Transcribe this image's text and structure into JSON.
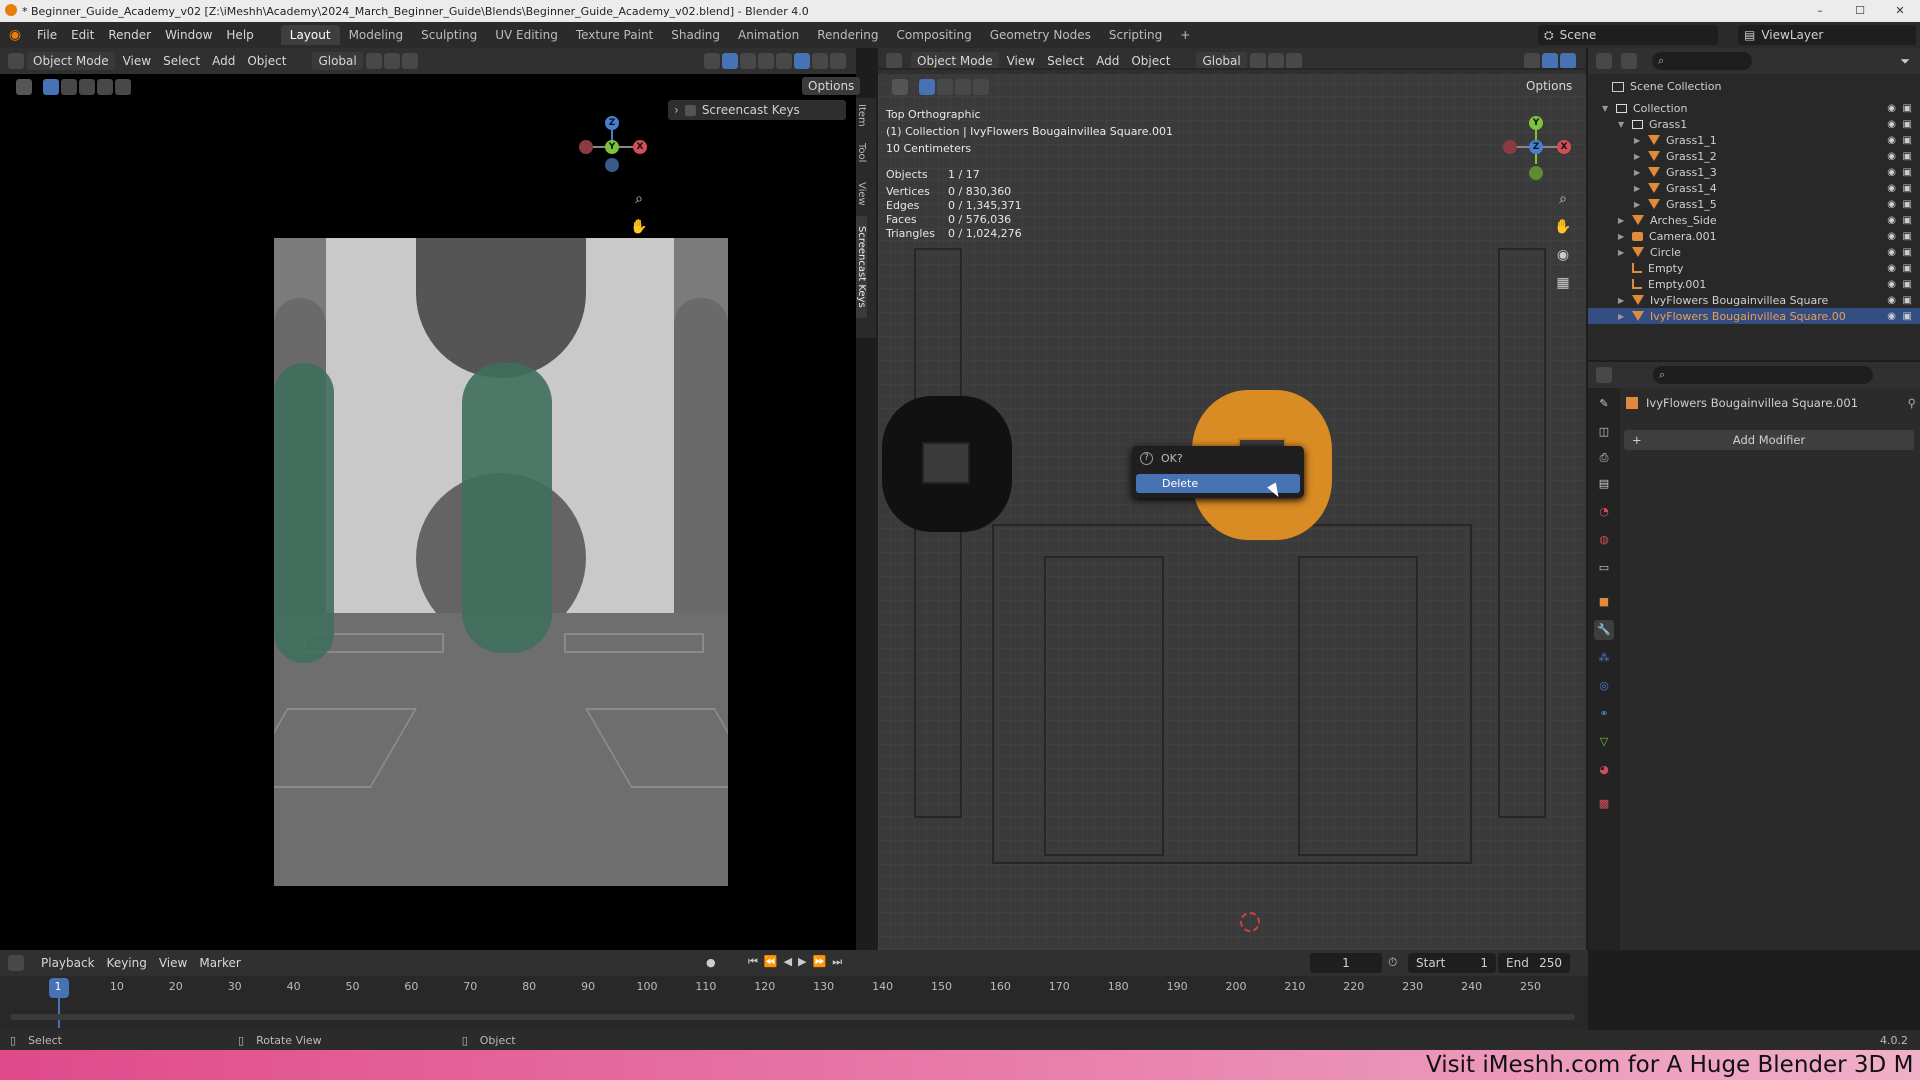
{
  "window": {
    "title": "* Beginner_Guide_Academy_v02 [Z:\\iMeshh\\Academy\\2024_March_Beginner_Guide\\Blends\\Beginner_Guide_Academy_v02.blend] - Blender 4.0",
    "controls": [
      "–",
      "☐",
      "✕"
    ]
  },
  "menubar": {
    "menus": [
      "File",
      "Edit",
      "Render",
      "Window",
      "Help"
    ],
    "workspaces": [
      "Layout",
      "Modeling",
      "Sculpting",
      "UV Editing",
      "Texture Paint",
      "Shading",
      "Animation",
      "Rendering",
      "Compositing",
      "Geometry Nodes",
      "Scripting",
      "+"
    ],
    "active_workspace": "Layout",
    "scene": "Scene",
    "view_layer": "ViewLayer"
  },
  "left_viewport": {
    "mode": "Object Mode",
    "menus": [
      "View",
      "Select",
      "Add",
      "Object"
    ],
    "transform": "Global",
    "options": "Options",
    "screencast_panel": "Screencast Keys",
    "side_tabs": [
      "Item",
      "Tool",
      "View",
      "Screencast Keys"
    ]
  },
  "right_viewport": {
    "mode": "Object Mode",
    "menus": [
      "View",
      "Select",
      "Add",
      "Object"
    ],
    "transform": "Global",
    "options": "Options",
    "view_name": "Top Orthographic",
    "collection_line": "(1) Collection | IvyFlowers Bougainvillea Square.001",
    "scale": "10 Centimeters",
    "stats": [
      {
        "label": "Objects",
        "value": "1 / 17"
      },
      {
        "label": "Vertices",
        "value": "0 / 830,360"
      },
      {
        "label": "Edges",
        "value": "0 / 1,345,371"
      },
      {
        "label": "Faces",
        "value": "0 / 576,036"
      },
      {
        "label": "Triangles",
        "value": "0 / 1,024,276"
      }
    ],
    "dialog": {
      "title": "OK?",
      "button": "Delete"
    }
  },
  "outliner": {
    "root": "Scene Collection",
    "rows": [
      {
        "label": "Collection",
        "indent": 1,
        "type": "collection"
      },
      {
        "label": "Grass1",
        "indent": 2,
        "type": "collection"
      },
      {
        "label": "Grass1_1",
        "indent": 3,
        "type": "mesh"
      },
      {
        "label": "Grass1_2",
        "indent": 3,
        "type": "mesh"
      },
      {
        "label": "Grass1_3",
        "indent": 3,
        "type": "mesh"
      },
      {
        "label": "Grass1_4",
        "indent": 3,
        "type": "mesh"
      },
      {
        "label": "Grass1_5",
        "indent": 3,
        "type": "mesh"
      },
      {
        "label": "Arches_Side",
        "indent": 2,
        "type": "mesh"
      },
      {
        "label": "Camera.001",
        "indent": 2,
        "type": "camera"
      },
      {
        "label": "Circle",
        "indent": 2,
        "type": "mesh"
      },
      {
        "label": "Empty",
        "indent": 2,
        "type": "empty"
      },
      {
        "label": "Empty.001",
        "indent": 2,
        "type": "empty"
      },
      {
        "label": "IvyFlowers Bougainvillea Square",
        "indent": 2,
        "type": "mesh"
      },
      {
        "label": "IvyFlowers Bougainvillea Square.00",
        "indent": 2,
        "type": "mesh-selected"
      }
    ]
  },
  "properties": {
    "object_name": "IvyFlowers Bougainvillea Square.001",
    "add_modifier": "Add Modifier"
  },
  "timeline": {
    "menus": [
      "Playback",
      "Keying",
      "View",
      "Marker"
    ],
    "current_frame": "1",
    "start_label": "Start",
    "start": "1",
    "end_label": "End",
    "end": "250",
    "ruler": [
      "1",
      "10",
      "20",
      "30",
      "40",
      "50",
      "60",
      "70",
      "80",
      "90",
      "100",
      "110",
      "120",
      "130",
      "140",
      "150",
      "160",
      "170",
      "180",
      "190",
      "200",
      "210",
      "220",
      "230",
      "240",
      "250"
    ]
  },
  "statusbar": {
    "items": [
      "Select",
      "Rotate View",
      "Object"
    ],
    "version": "4.0.2"
  },
  "banner": {
    "text": "Visit iMeshh.com for A Huge Blender 3D M"
  }
}
